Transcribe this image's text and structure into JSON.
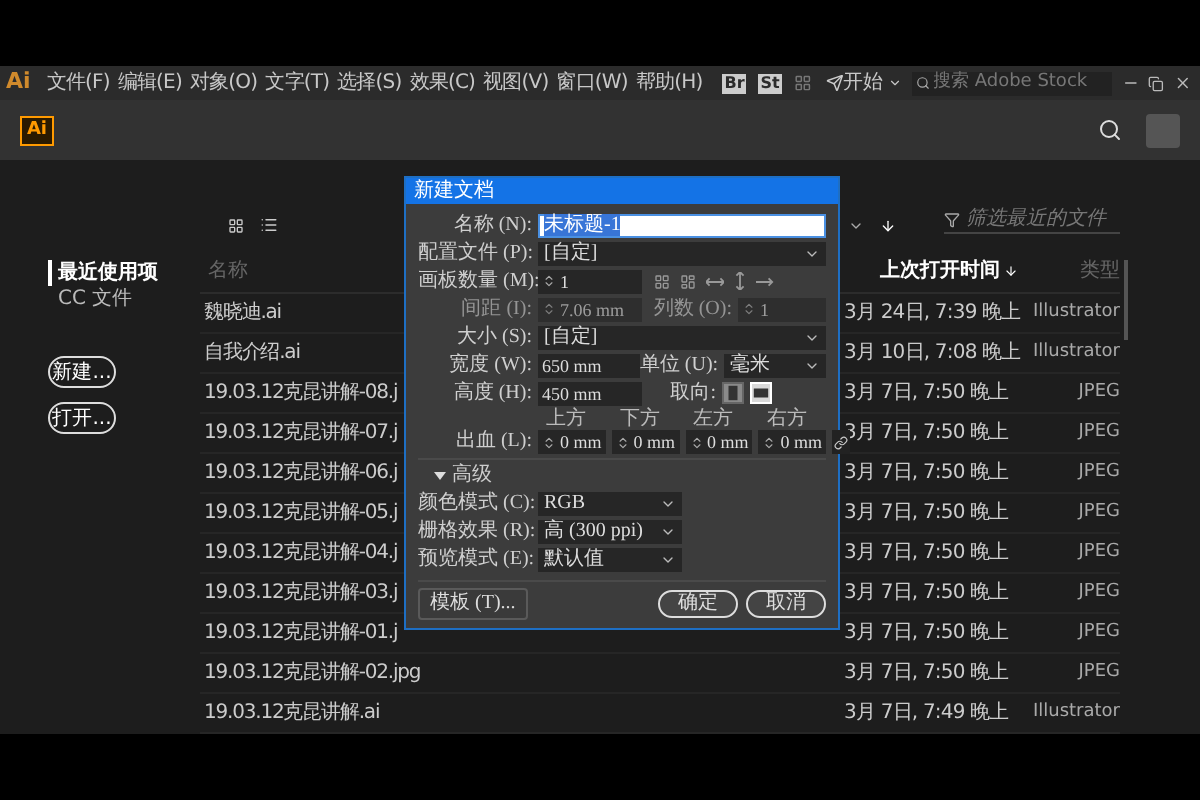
{
  "menubar": {
    "logo": "Ai",
    "menus": [
      "文件(F)",
      "编辑(E)",
      "对象(O)",
      "文字(T)",
      "选择(S)",
      "效果(C)",
      "视图(V)",
      "窗口(W)",
      "帮助(H)"
    ],
    "bridge": "Br",
    "stock": "St",
    "workspace": "开始",
    "search": {
      "placeholder": "搜索 Adobe Stock"
    }
  },
  "header": {
    "logo": "Ai"
  },
  "sidebar": {
    "items": [
      {
        "label": "最近使用项",
        "selected": true
      },
      {
        "label": "CC 文件",
        "selected": false
      }
    ],
    "buttons": [
      "新建...",
      "打开..."
    ]
  },
  "file_list": {
    "filter": {
      "placeholder": "筛选最近的文件"
    },
    "columns": [
      {
        "label": "名称",
        "sorted": false
      },
      {
        "label": "上次打开时间",
        "sorted": true
      },
      {
        "label": "类型",
        "sorted": false
      }
    ],
    "rows": [
      {
        "name": "魏晓迪.ai",
        "opened": "3月 24日, 7:39 晚上",
        "type": "Illustrator"
      },
      {
        "name": "自我介绍.ai",
        "opened": "3月 10日, 7:08 晚上",
        "type": "Illustrator"
      },
      {
        "name": "19.03.12克昆讲解-08.j",
        "opened": "3月 7日, 7:50 晚上",
        "type": "JPEG"
      },
      {
        "name": "19.03.12克昆讲解-07.j",
        "opened": "3月 7日, 7:50 晚上",
        "type": "JPEG"
      },
      {
        "name": "19.03.12克昆讲解-06.j",
        "opened": "3月 7日, 7:50 晚上",
        "type": "JPEG"
      },
      {
        "name": "19.03.12克昆讲解-05.j",
        "opened": "3月 7日, 7:50 晚上",
        "type": "JPEG"
      },
      {
        "name": "19.03.12克昆讲解-04.j",
        "opened": "3月 7日, 7:50 晚上",
        "type": "JPEG"
      },
      {
        "name": "19.03.12克昆讲解-03.j",
        "opened": "3月 7日, 7:50 晚上",
        "type": "JPEG"
      },
      {
        "name": "19.03.12克昆讲解-01.j",
        "opened": "3月 7日, 7:50 晚上",
        "type": "JPEG"
      },
      {
        "name": "19.03.12克昆讲解-02.jpg",
        "opened": "3月 7日, 7:50 晚上",
        "type": "JPEG"
      },
      {
        "name": "19.03.12克昆讲解.ai",
        "opened": "3月 7日, 7:49 晚上",
        "type": "Illustrator"
      }
    ]
  },
  "dialog": {
    "title": "新建文档",
    "fields": [
      {
        "kind": "text",
        "disabled": false,
        "label": "名称 (N):",
        "value": "未标题-1"
      },
      {
        "kind": "select",
        "disabled": false,
        "label": "配置文件 (P):",
        "value": "[自定]"
      },
      {
        "kind": "artboards",
        "disabled": false,
        "label": "画板数量 (M):",
        "value": "1"
      },
      {
        "kind": "pair",
        "disabled": true,
        "label": "间距 (I):",
        "value": "7.06 mm",
        "label2": "列数 (O):",
        "value2": "1"
      },
      {
        "kind": "select",
        "disabled": false,
        "label": "大小 (S):",
        "value": "[自定]"
      },
      {
        "kind": "unit",
        "disabled": false,
        "label": "宽度 (W):",
        "value": "650 mm",
        "label2": "单位 (U):",
        "value2": "毫米"
      },
      {
        "kind": "orientation",
        "disabled": false,
        "label": "高度 (H):",
        "value": "450 mm",
        "label2": "取向:",
        "options": [
          {
            "kind": "portrait",
            "selected": false
          },
          {
            "kind": "landscape",
            "selected": true
          }
        ]
      },
      {
        "kind": "bleed",
        "disabled": false,
        "label": "出血 (L):",
        "sides": [
          {
            "label": "上方",
            "value": "0 mm"
          },
          {
            "label": "下方",
            "value": "0 mm"
          },
          {
            "label": "左方",
            "value": "0 mm"
          },
          {
            "label": "右方",
            "value": "0 mm"
          }
        ]
      }
    ],
    "advanced": {
      "label": "高级",
      "expanded": true,
      "fields": [
        {
          "label": "颜色模式 (C):",
          "value": "RGB"
        },
        {
          "label": "栅格效果 (R):",
          "value": "高 (300 ppi)"
        },
        {
          "label": "预览模式 (E):",
          "value": "默认值"
        }
      ]
    },
    "buttons": [
      {
        "kind": "template",
        "label": "模板 (T)..."
      },
      {
        "kind": "ok",
        "label": "确定"
      },
      {
        "kind": "cancel",
        "label": "取消"
      }
    ]
  }
}
